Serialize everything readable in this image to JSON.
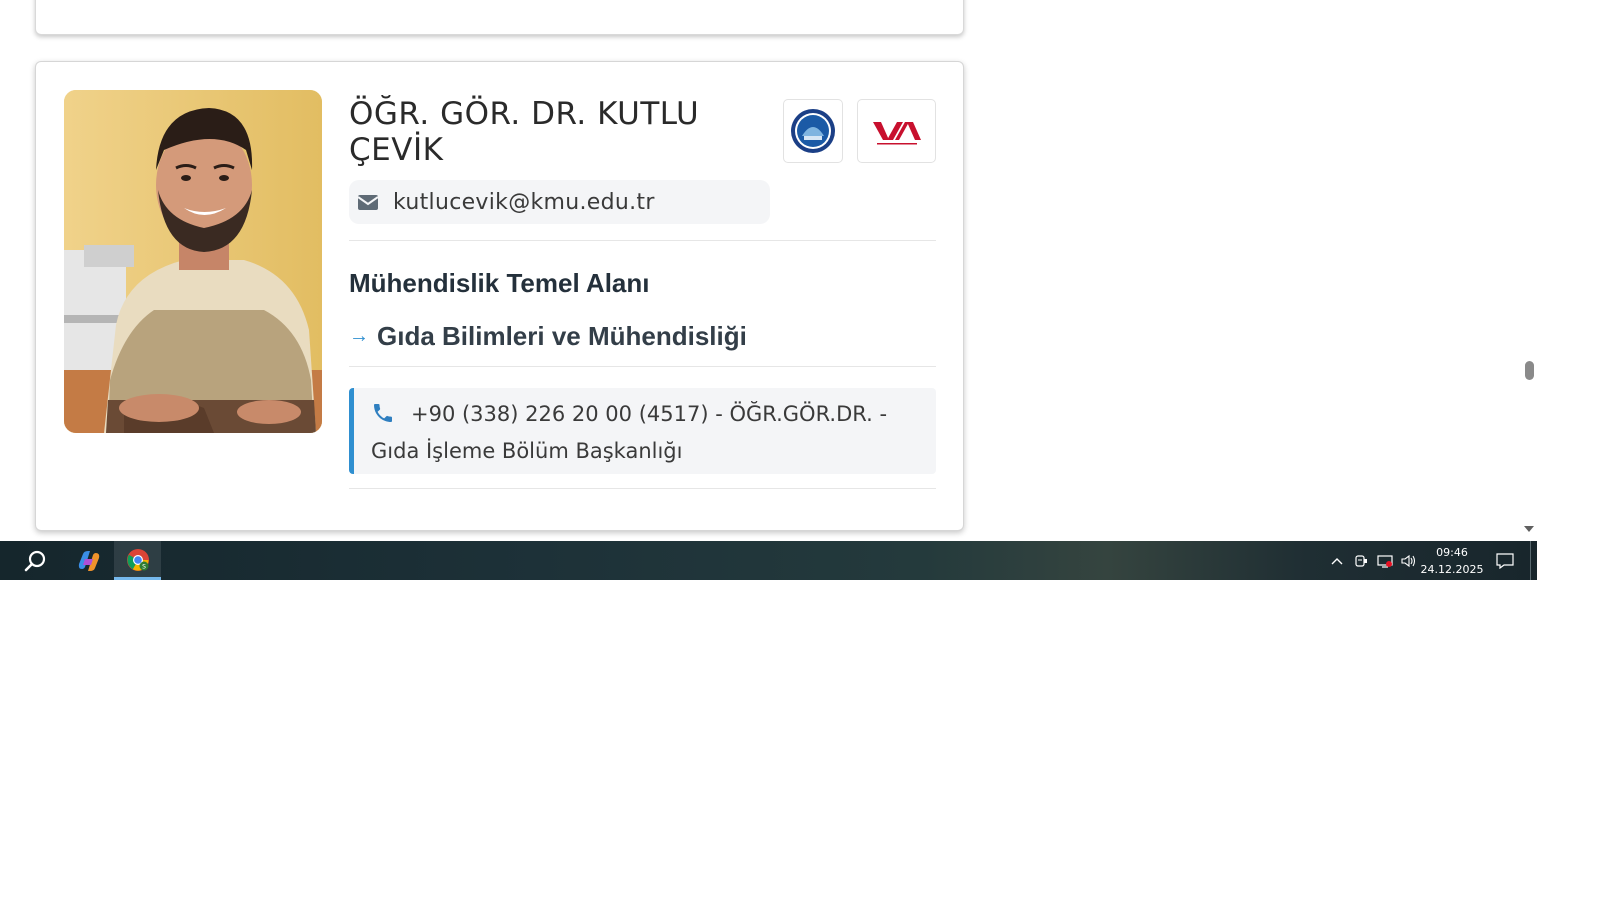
{
  "profile": {
    "name": "ÖĞR. GÖR. DR. KUTLU ÇEVİK",
    "email": "kutlucevik@kmu.edu.tr",
    "field": "Mühendislik Temel Alanı",
    "subfield": "Gıda Bilimleri ve Mühendisliği",
    "subfield_arrow": "→",
    "contact": "+90 (338) 226 20 00 (4517) - ÖĞR.GÖR.DR. - Gıda İşleme Bölüm Başkanlığı",
    "logos": [
      "kmu-university-logo",
      "yok-logo"
    ]
  },
  "taskbar": {
    "apps": [
      "search-icon",
      "copilot-icon",
      "chrome-icon"
    ],
    "active_app": "chrome",
    "tray_icons": [
      "chevron-up-icon",
      "meet-now-icon",
      "network-icon",
      "volume-icon"
    ],
    "time": "09:46",
    "date": "24.12.2025"
  },
  "colors": {
    "accent": "#2f8fd0",
    "taskbar": "#1d3138",
    "card_border": "#d6d6d6"
  }
}
